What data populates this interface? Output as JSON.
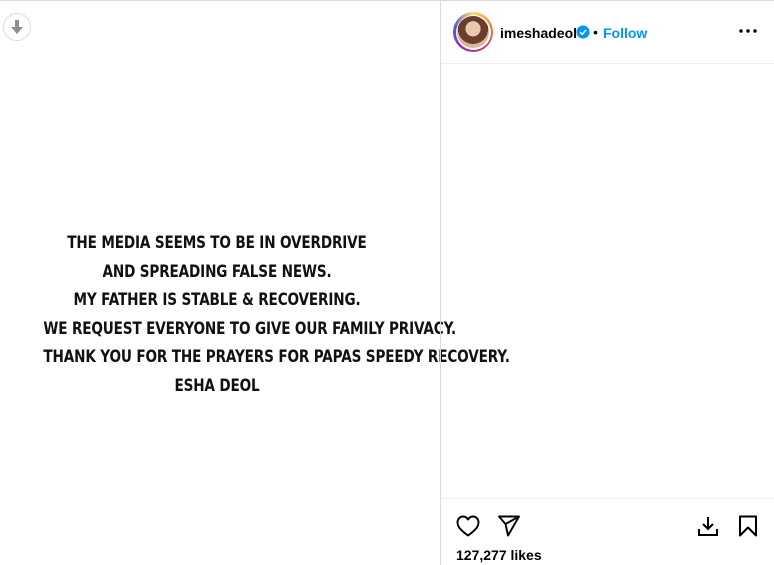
{
  "post": {
    "lines": [
      "THE MEDIA SEEMS TO BE IN OVERDRIVE",
      "AND SPREADING FALSE NEWS.",
      "MY FATHER IS STABLE & RECOVERING.",
      "WE REQUEST EVERYONE TO GIVE OUR FAMILY PRIVACY.",
      "THANK YOU FOR THE PRAYERS FOR PAPAS SPEEDY RECOVERY.",
      "ESHA DEOL"
    ]
  },
  "header": {
    "username": "imeshadeol",
    "separator": "•",
    "follow_label": "Follow"
  },
  "footer": {
    "likes_text": "127,277 likes"
  },
  "colors": {
    "follow": "#0095f6",
    "verified": "#0095f6",
    "border": "#dbdbdb"
  },
  "icons": {
    "media_download": "arrow-down-icon",
    "verified": "verified-badge-icon",
    "more": "more-options-icon",
    "like": "heart-icon",
    "share": "send-icon",
    "download": "download-icon",
    "save": "bookmark-icon"
  }
}
